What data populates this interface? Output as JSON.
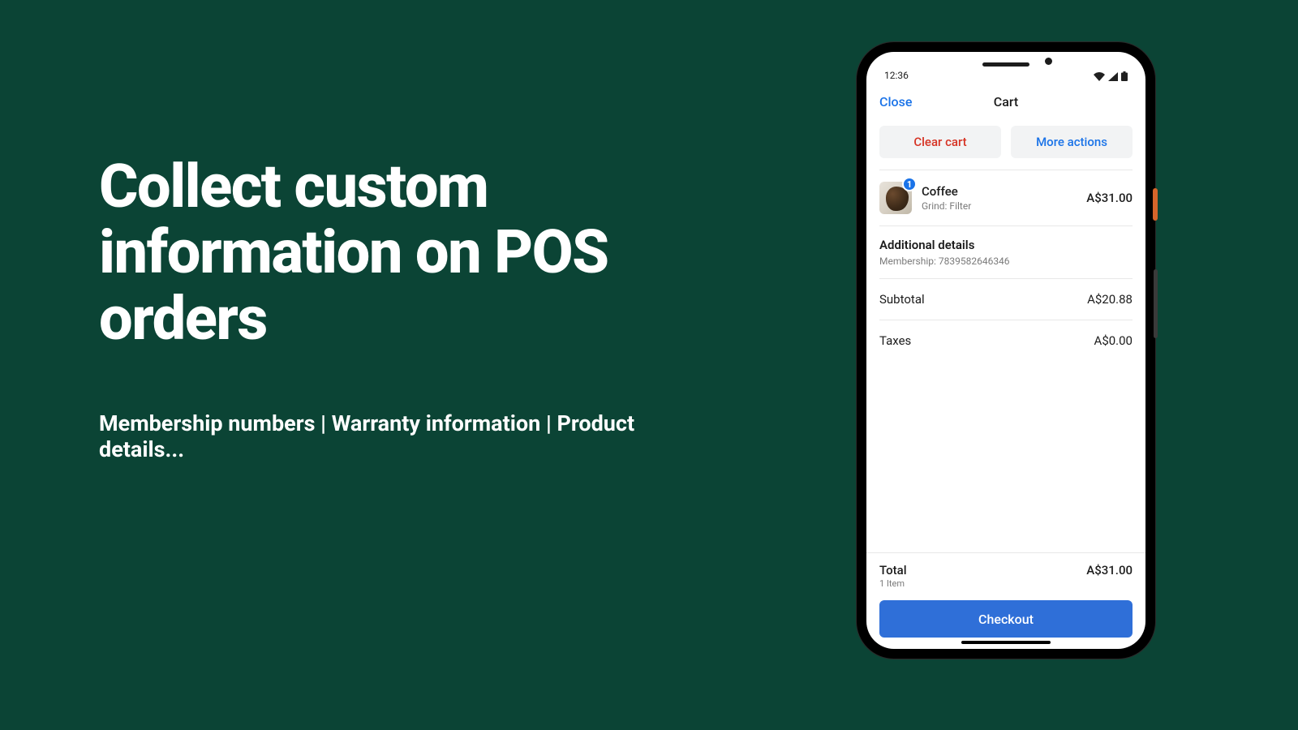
{
  "marketing": {
    "headline": "Collect custom information on POS orders",
    "subline": "Membership numbers | Warranty information | Product details..."
  },
  "status": {
    "time": "12:36"
  },
  "nav": {
    "close": "Close",
    "title": "Cart"
  },
  "actions": {
    "clear": "Clear cart",
    "more": "More actions"
  },
  "item": {
    "qty": "1",
    "name": "Coffee",
    "variant": "Grind: Filter",
    "price": "A$31.00"
  },
  "details": {
    "heading": "Additional details",
    "line": "Membership: 7839582646346"
  },
  "subtotal": {
    "label": "Subtotal",
    "value": "A$20.88"
  },
  "taxes": {
    "label": "Taxes",
    "value": "A$0.00"
  },
  "total": {
    "label": "Total",
    "count": "1 Item",
    "value": "A$31.00"
  },
  "checkout": "Checkout"
}
